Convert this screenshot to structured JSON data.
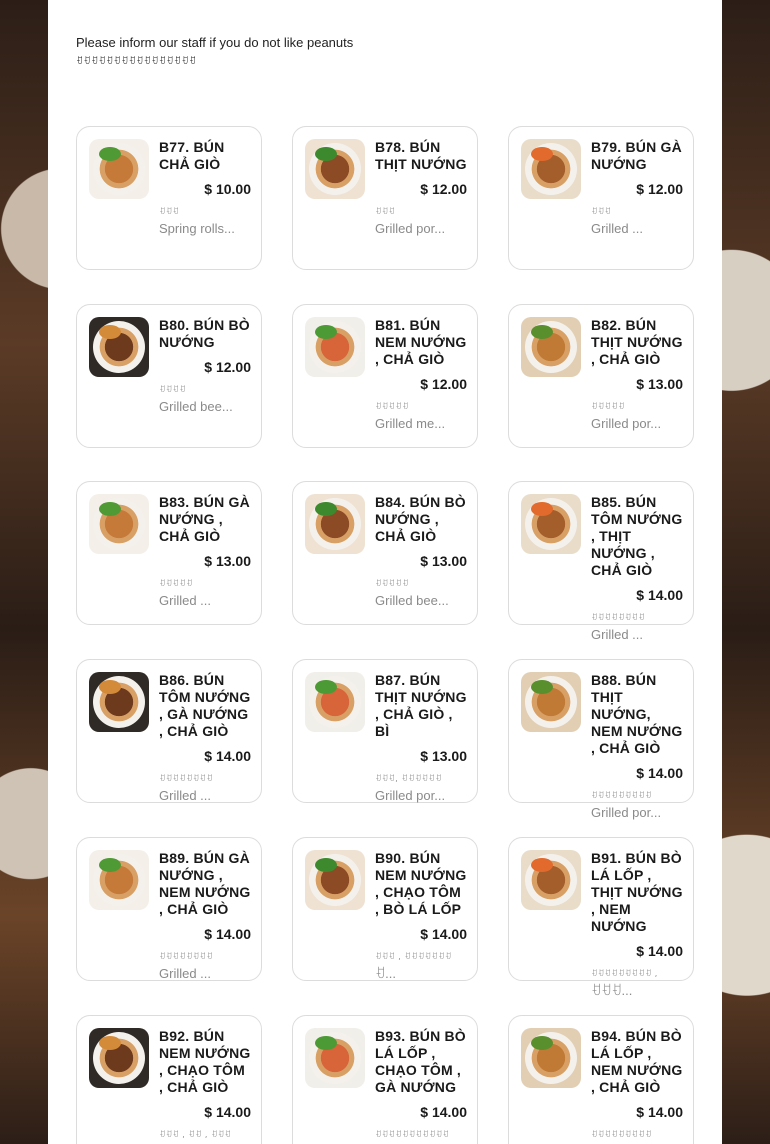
{
  "notice": {
    "glyph": "",
    "message": "Please inform our staff if you do not like peanuts",
    "local_message": "ꀀꀀꀀꀀꀀꀀꀀꀀꀀꀀꀀꀀꀀꀀꀀꀀ"
  },
  "menu": [
    {
      "name": "B77. BÚN CHẢ GIÒ",
      "price": "$ 10.00",
      "local": "ꀀꀀꀀ",
      "desc": "Spring rolls..."
    },
    {
      "name": "B78. BÚN THỊT NƯỚNG",
      "price": "$ 12.00",
      "local": "ꀀꀀꀀ",
      "desc": "Grilled por..."
    },
    {
      "name": "B79. BÚN GÀ NƯỚNG",
      "price": "$ 12.00",
      "local": "ꀀꀀꀀ",
      "desc": "Grilled ..."
    },
    {
      "name": "B80. BÚN BÒ NƯỚNG",
      "price": "$ 12.00",
      "local": "ꀀꀀꀀꀀ",
      "desc": "Grilled bee..."
    },
    {
      "name": "B81. BÚN NEM NƯỚNG , CHẢ GIÒ",
      "price": "$ 12.00",
      "local": "ꀀꀀꀀꀀꀀ",
      "desc": "Grilled me..."
    },
    {
      "name": "B82. BÚN THỊT NƯỚNG , CHẢ GIÒ",
      "price": "$ 13.00",
      "local": "ꀀꀀꀀꀀꀀ",
      "desc": "Grilled por..."
    },
    {
      "name": "B83. BÚN GÀ NƯỚNG , CHẢ GIÒ",
      "price": "$ 13.00",
      "local": "ꀀꀀꀀꀀꀀ",
      "desc": "Grilled ..."
    },
    {
      "name": "B84. BÚN BÒ NƯỚNG , CHẢ GIÒ",
      "price": "$ 13.00",
      "local": "ꀀꀀꀀꀀꀀ",
      "desc": "Grilled bee..."
    },
    {
      "name": "B85. BÚN TÔM NƯỚNG , THỊT NƯỚNG , CHẢ GIÒ",
      "price": "$ 14.00",
      "local": "ꀀꀀꀀꀀꀀꀀꀀꀀ",
      "desc": "Grilled ..."
    },
    {
      "name": "B86. BÚN TÔM NƯỚNG , GÀ NƯỚNG , CHẢ GIÒ",
      "price": "$ 14.00",
      "local": "ꀀꀀꀀꀀꀀꀀꀀꀀ",
      "desc": "Grilled ..."
    },
    {
      "name": "B87. BÚN THỊT NƯỚNG , CHẢ GIÒ , BÌ",
      "price": "$ 13.00",
      "local": "ꀀꀀꀀ,  ꀀꀀꀀꀀꀀꀀ",
      "desc": "Grilled por..."
    },
    {
      "name": "B88. BÚN THỊT NƯỚNG, NEM NƯỚNG , CHẢ GIÒ",
      "price": "$ 14.00",
      "local": "ꀀꀀꀀꀀꀀꀀꀀꀀꀀ",
      "desc": "Grilled por..."
    },
    {
      "name": "B89. BÚN GÀ NƯỚNG , NEM NƯỚNG , CHẢ GIÒ",
      "price": "$ 14.00",
      "local": "ꀀꀀꀀꀀꀀꀀꀀꀀ",
      "desc": "Grilled ..."
    },
    {
      "name": "B90. BÚN NEM NƯỚNG , CHẠO TÔM , BÒ LÁ LỐP",
      "price": "$ 14.00",
      "local": "ꀀꀀꀀ , ꀀꀀꀀꀀꀀꀀꀀ",
      "desc": "ꀀ..."
    },
    {
      "name": "B91. BÚN BÒ LÁ LỐP , THỊT NƯỚNG , NEM NƯỚNG",
      "price": "$ 14.00",
      "local": "ꀀꀀꀀꀀꀀꀀꀀꀀꀀ ,",
      "desc": " ꀀꀀꀀ..."
    },
    {
      "name": "B92. BÚN NEM NƯỚNG , CHẠO TÔM , CHẢ GIÒ",
      "price": "$ 14.00",
      "local": "ꀀꀀꀀ , ꀀꀀ , ꀀꀀꀀ",
      "desc": ""
    },
    {
      "name": "B93. BÚN BÒ LÁ LỐP , CHẠO TÔM , GÀ NƯỚNG",
      "price": "$ 14.00",
      "local": "ꀀꀀꀀꀀꀀꀀꀀꀀꀀꀀꀀ",
      "desc": ""
    },
    {
      "name": "B94. BÚN BÒ LÁ LỐP , NEM NƯỚNG , CHẢ GIÒ",
      "price": "$ 14.00",
      "local": "ꀀꀀꀀꀀꀀꀀꀀꀀꀀ",
      "desc": ""
    }
  ]
}
